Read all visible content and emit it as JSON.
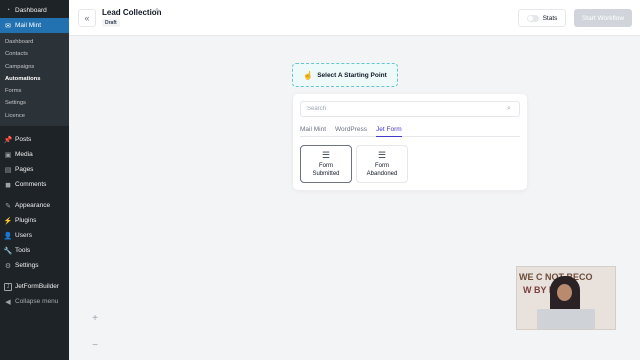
{
  "sidebar": {
    "top": [
      {
        "label": "Dashboard",
        "icon": "dashboard-icon"
      },
      {
        "label": "Mail Mint",
        "icon": "mail-icon",
        "active": true
      }
    ],
    "submenu": [
      "Dashboard",
      "Contacts",
      "Campaigns",
      "Automations",
      "Forms",
      "Settings",
      "Licence"
    ],
    "submenu_current": "Automations",
    "items": [
      {
        "label": "Posts",
        "icon": "pin-icon"
      },
      {
        "label": "Media",
        "icon": "media-icon"
      },
      {
        "label": "Pages",
        "icon": "pages-icon"
      },
      {
        "label": "Comments",
        "icon": "comments-icon"
      },
      {
        "label": "Appearance",
        "icon": "brush-icon"
      },
      {
        "label": "Plugins",
        "icon": "plugin-icon"
      },
      {
        "label": "Users",
        "icon": "users-icon"
      },
      {
        "label": "Tools",
        "icon": "wrench-icon"
      },
      {
        "label": "Settings",
        "icon": "settings-icon"
      },
      {
        "label": "JetFormBuilder",
        "icon": "jet-icon"
      },
      {
        "label": "Collapse menu",
        "icon": "collapse-icon"
      }
    ]
  },
  "header": {
    "title": "Lead Collection",
    "status": "Draft",
    "stats_label": "Stats",
    "start_label": "Start Workflow"
  },
  "canvas": {
    "starting_point_label": "Select A Starting Point",
    "search_placeholder": "Search",
    "tabs": [
      "Mail Mint",
      "WordPress",
      "Jet Form"
    ],
    "active_tab": "Jet Form",
    "triggers": [
      {
        "label_line1": "Form",
        "label_line2": "Submitted",
        "icon": "form-submitted-icon",
        "selected": true
      },
      {
        "label_line1": "Form",
        "label_line2": "Abandoned",
        "icon": "form-abandoned-icon",
        "selected": false
      }
    ],
    "zoom_in": "+",
    "zoom_out": "−"
  },
  "colors": {
    "wp_sidebar": "#1d2327",
    "wp_active": "#2271b1",
    "accent": "#4338ca",
    "starting_point_border": "#67c5cf"
  }
}
